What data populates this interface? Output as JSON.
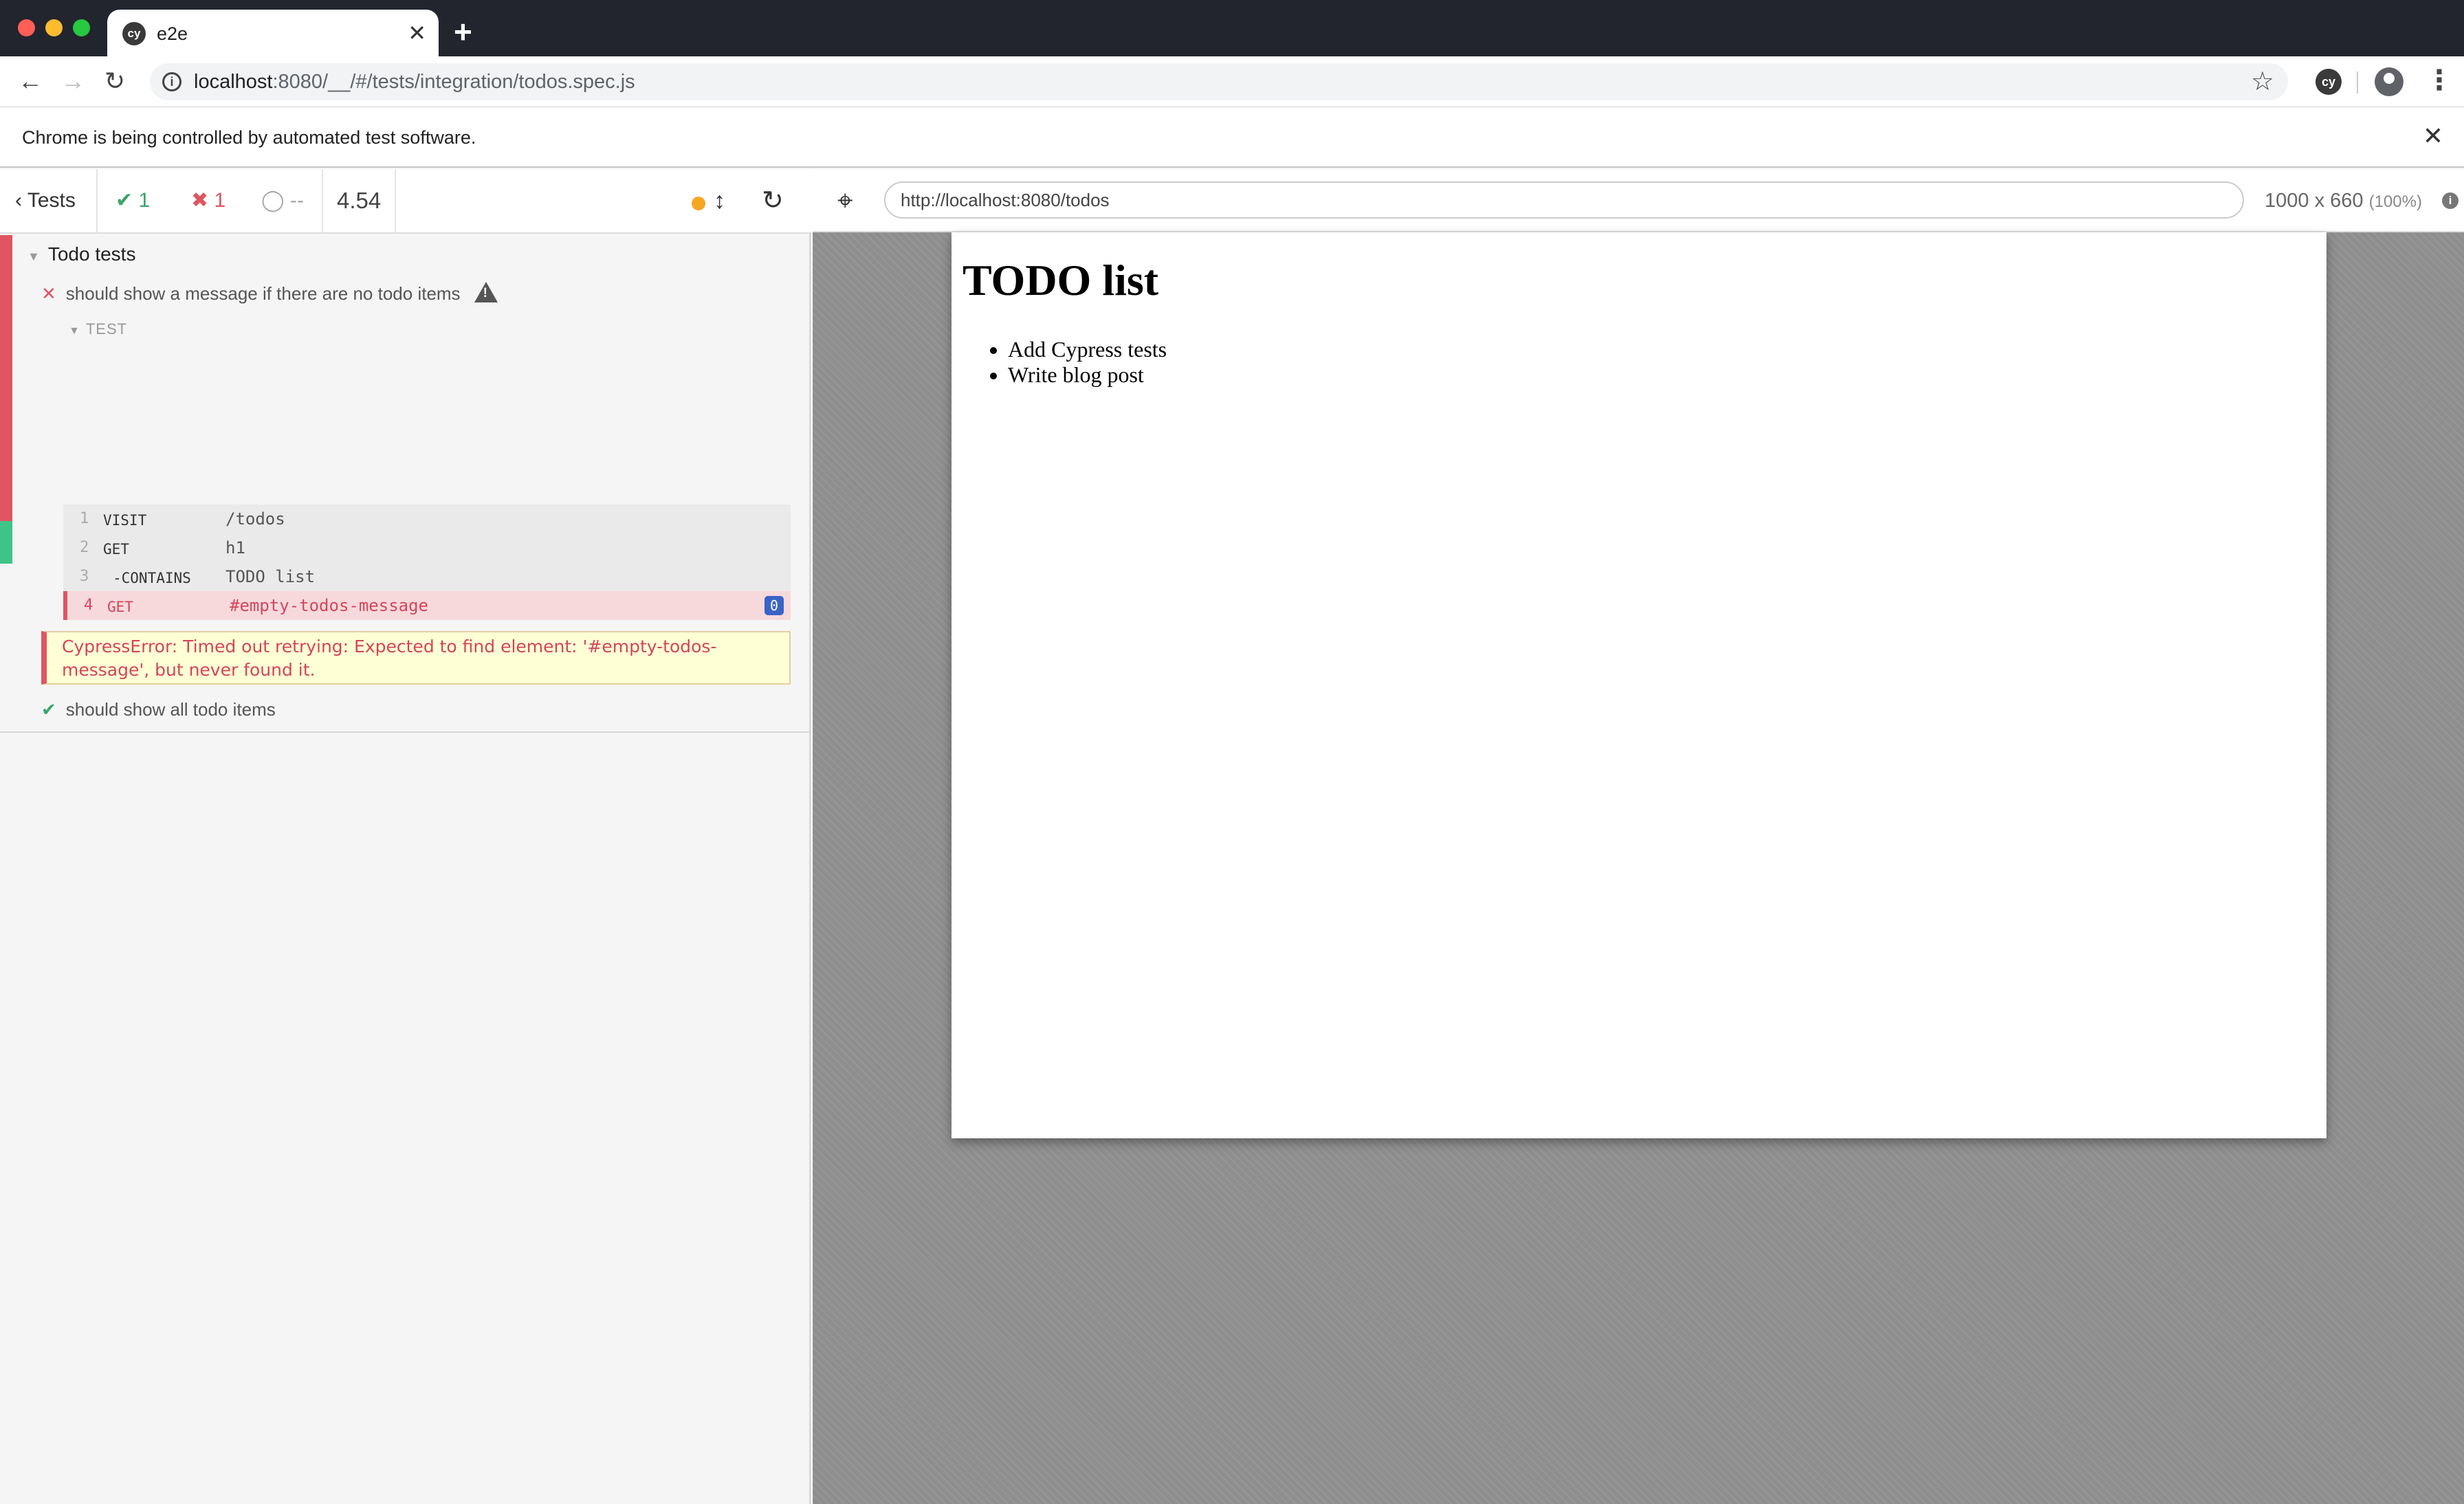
{
  "browser": {
    "tab_title": "e2e",
    "tab_favicon_text": "cy",
    "new_tab_symbol": "+",
    "url_host": "localhost",
    "url_rest": ":8080/__/#/tests/integration/todos.spec.js",
    "ext_text": "cy",
    "icons": [
      "back-arrow-icon",
      "forward-arrow-icon",
      "reload-icon",
      "info-icon",
      "star-icon",
      "profile-icon",
      "kebab-menu-icon",
      "close-icon"
    ]
  },
  "infobar": {
    "message": "Chrome is being controlled by automated test software."
  },
  "reporter": {
    "header": {
      "tests_label": "Tests",
      "passed_count": "1",
      "failed_count": "1",
      "pending_count": "--",
      "duration": "4.54"
    },
    "suite": {
      "title": "Todo tests",
      "tests": [
        {
          "title": "should show a message if there are no todo items",
          "state": "failed",
          "block_label": "TEST",
          "commands": [
            {
              "num": "1",
              "name": "visit",
              "arg": "/todos"
            },
            {
              "num": "2",
              "name": "get",
              "arg": "h1"
            },
            {
              "num": "3",
              "name": "-contains",
              "arg": "TODO list"
            },
            {
              "num": "4",
              "name": "get",
              "arg": "#empty-todos-message",
              "badge": "0",
              "state": "failed"
            }
          ],
          "error": "CypressError: Timed out retrying: Expected to find element: '#empty-todos-message', but never found it."
        },
        {
          "title": "should show all todo items",
          "state": "passed"
        }
      ]
    },
    "colors": {
      "passed": "#3aa569",
      "failed": "#e05561",
      "pending": "#a6a6a6",
      "running_dot": "#f5a623"
    }
  },
  "aut": {
    "url": "http://localhost:8080/todos",
    "viewport_size": "1000 x 660",
    "viewport_scale": "(100%)",
    "page": {
      "heading": "TODO list",
      "items": [
        "Add Cypress tests",
        "Write blog post"
      ]
    }
  }
}
